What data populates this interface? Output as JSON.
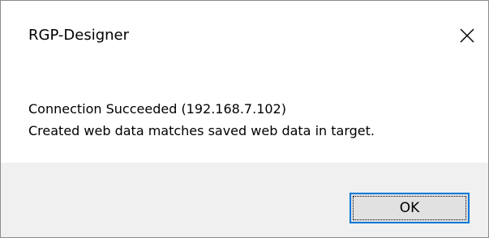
{
  "dialog": {
    "title": "RGP-Designer",
    "close_icon": "close-icon",
    "message_line1": "Connection Succeeded (192.168.7.102)",
    "message_line2": "Created web data matches saved web data in target.",
    "ok_label": "OK"
  },
  "colors": {
    "footer_background": "#f0f0f0",
    "button_border_accent": "#0078d7",
    "button_background": "#e1e1e1"
  }
}
